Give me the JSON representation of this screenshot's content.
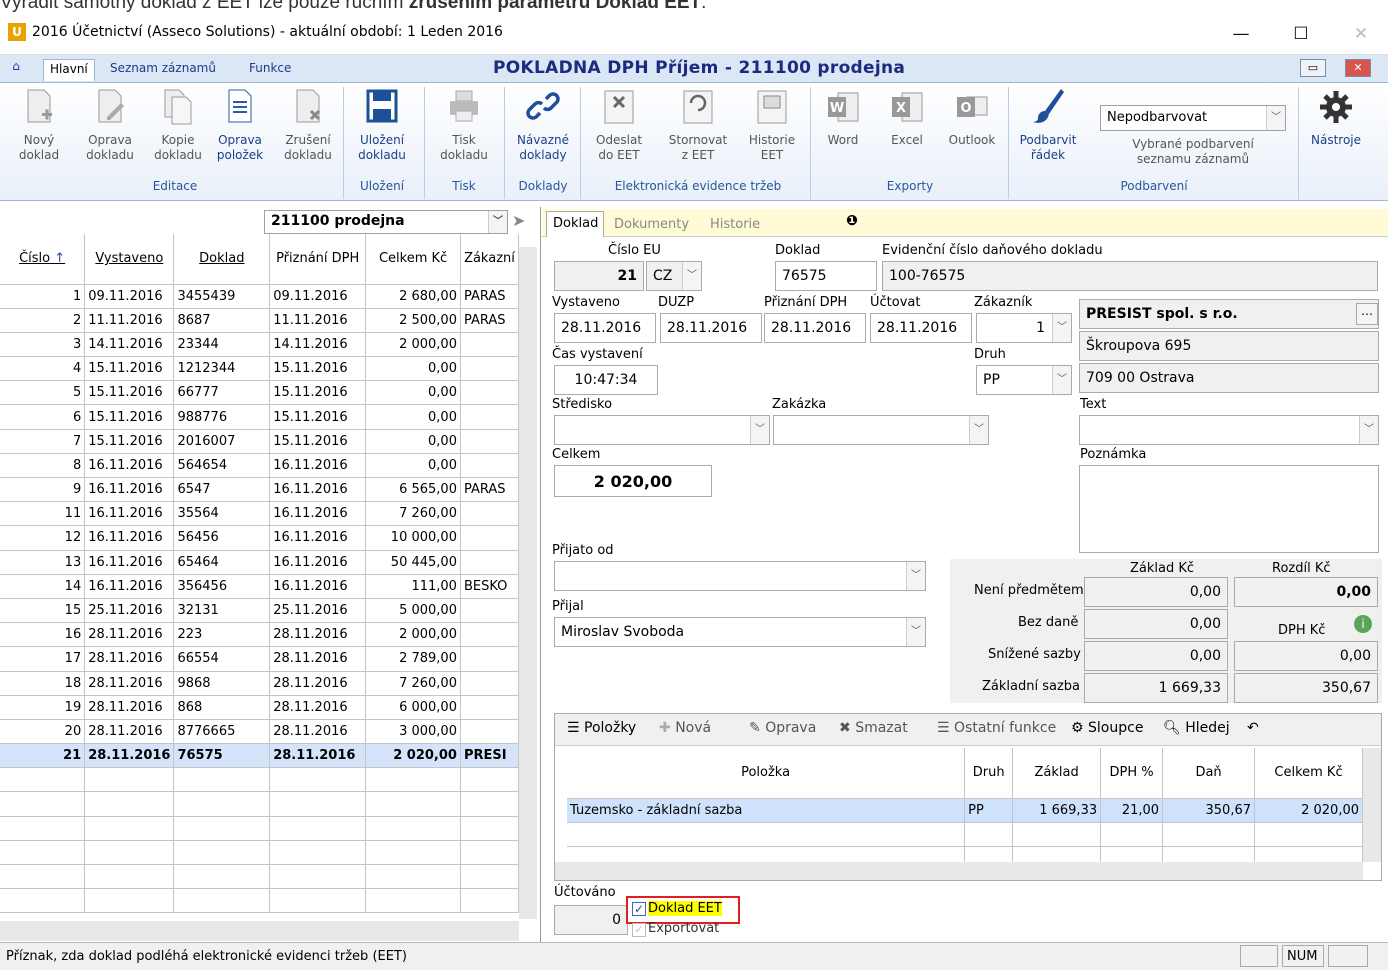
{
  "caption": {
    "pre": "Vyradit samotny doklad z EET lze pouze ručním ",
    "bold": "zrušením parametru Doklad EET",
    "post": "."
  },
  "window": {
    "icon": "U",
    "title": "2016 Účetnictví (Asseco Solutions)  -  aktuální období: 1 Leden 2016",
    "min": "—",
    "max": "☐",
    "close": "✕"
  },
  "tabs": [
    "Hlavní",
    "Seznam záznamů",
    "Funkce"
  ],
  "form_title": "POKLADNA DPH Příjem - 211100  prodejna",
  "ribbon": {
    "buttons": [
      {
        "l1": "Nový",
        "l2": "doklad"
      },
      {
        "l1": "Oprava",
        "l2": "dokladu"
      },
      {
        "l1": "Kopie",
        "l2": "dokladu"
      },
      {
        "l1": "Oprava",
        "l2": "položek"
      },
      {
        "l1": "Zrušení",
        "l2": "dokladu"
      },
      {
        "l1": "Uložení",
        "l2": "dokladu"
      },
      {
        "l1": "Tisk",
        "l2": "dokladu"
      },
      {
        "l1": "Návazné",
        "l2": "doklady"
      },
      {
        "l1": "Odeslat",
        "l2": "do EET"
      },
      {
        "l1": "Stornovat",
        "l2": "z EET"
      },
      {
        "l1": "Historie",
        "l2": "EET"
      },
      {
        "l1": "Word",
        "l2": ""
      },
      {
        "l1": "Excel",
        "l2": ""
      },
      {
        "l1": "Outlook",
        "l2": ""
      },
      {
        "l1": "Podbarvit",
        "l2": "řádek"
      },
      {
        "l1": "Nástroje",
        "l2": ""
      }
    ],
    "groups": [
      "Editace",
      "Uložení",
      "Tisk",
      "Doklady",
      "Elektronická evidence tržeb",
      "Exporty",
      "Podbarvení"
    ],
    "color_select": "Nepodbarvovat",
    "color_note1": "Vybrané podbarvení",
    "color_note2": "seznamu záznamů",
    "eet_badge": "EET",
    "office": {
      "word": "W",
      "excel": "X",
      "outlook": "O"
    }
  },
  "list": {
    "selector": "211100   prodejna",
    "headers": [
      "Číslo",
      "Vystaveno",
      "Doklad",
      "Přiznání DPH",
      "Celkem Kč",
      "Zákazní"
    ],
    "rows": [
      [
        "1",
        "09.11.2016",
        "3455439",
        "09.11.2016",
        "2 680,00",
        "PARAS"
      ],
      [
        "2",
        "11.11.2016",
        "8687",
        "11.11.2016",
        "2 500,00",
        "PARAS"
      ],
      [
        "3",
        "14.11.2016",
        "23344",
        "14.11.2016",
        "2 000,00",
        ""
      ],
      [
        "4",
        "15.11.2016",
        "1212344",
        "15.11.2016",
        "0,00",
        ""
      ],
      [
        "5",
        "15.11.2016",
        "66777",
        "15.11.2016",
        "0,00",
        ""
      ],
      [
        "6",
        "15.11.2016",
        "988776",
        "15.11.2016",
        "0,00",
        ""
      ],
      [
        "7",
        "15.11.2016",
        "2016007",
        "15.11.2016",
        "0,00",
        ""
      ],
      [
        "8",
        "16.11.2016",
        "564654",
        "16.11.2016",
        "0,00",
        ""
      ],
      [
        "9",
        "16.11.2016",
        "6547",
        "16.11.2016",
        "6 565,00",
        "PARAS"
      ],
      [
        "11",
        "16.11.2016",
        "35564",
        "16.11.2016",
        "7 260,00",
        ""
      ],
      [
        "12",
        "16.11.2016",
        "56456",
        "16.11.2016",
        "10 000,00",
        ""
      ],
      [
        "13",
        "16.11.2016",
        "65464",
        "16.11.2016",
        "50 445,00",
        ""
      ],
      [
        "14",
        "16.11.2016",
        "356456",
        "16.11.2016",
        "111,00",
        "BESKO"
      ],
      [
        "15",
        "25.11.2016",
        "32131",
        "25.11.2016",
        "5 000,00",
        ""
      ],
      [
        "16",
        "28.11.2016",
        "223",
        "28.11.2016",
        "2 000,00",
        ""
      ],
      [
        "17",
        "28.11.2016",
        "66554",
        "28.11.2016",
        "2 789,00",
        ""
      ],
      [
        "18",
        "28.11.2016",
        "9868",
        "28.11.2016",
        "7 260,00",
        ""
      ],
      [
        "19",
        "28.11.2016",
        "868",
        "28.11.2016",
        "6 000,00",
        ""
      ],
      [
        "20",
        "28.11.2016",
        "8776665",
        "28.11.2016",
        "3 000,00",
        ""
      ],
      [
        "21",
        "28.11.2016",
        "76575",
        "28.11.2016",
        "2 020,00",
        "PRESI"
      ]
    ]
  },
  "detail": {
    "tabs": [
      "Doklad",
      "Dokumenty",
      "Historie"
    ],
    "lbl_cislo_eu": "Číslo EU",
    "cislo": "21",
    "zeme": "CZ",
    "lbl_doklad": "Doklad",
    "doklad": "76575",
    "lbl_evid": "Evidenční číslo daňového dokladu",
    "evid": "100-76575",
    "lbl_vystaveno": "Vystaveno",
    "vystaveno": "28.11.2016",
    "lbl_duzp": "DUZP",
    "duzp": "28.11.2016",
    "lbl_priznani": "Přiznání DPH",
    "priznani": "28.11.2016",
    "lbl_uctovat": "Účtovat",
    "uctovat": "28.11.2016",
    "lbl_zakaznik": "Zákazník",
    "zakaznik": "1",
    "cust_name": "PRESIST spol. s r.o.",
    "cust_street": "Škroupova 695",
    "cust_city": "709 00 Ostrava",
    "lbl_cas": "Čas vystavení",
    "cas": "10:47:34",
    "lbl_druh": "Druh",
    "druh": "PP",
    "lbl_stredisko": "Středisko",
    "lbl_zakazka": "Zakázka",
    "lbl_text": "Text",
    "lbl_celkem": "Celkem",
    "celkem": "2 020,00",
    "lbl_poznamka": "Poznámka",
    "lbl_prijato": "Přijato od",
    "lbl_prijal": "Přijal",
    "prijal": "Miroslav Svoboda",
    "vat": {
      "h_zaklad": "Základ Kč",
      "h_rozdil": "Rozdíl Kč",
      "h_dph": "DPH Kč",
      "rows": [
        {
          "label": "Není předmětem",
          "zaklad": "0,00",
          "other": "0,00"
        },
        {
          "label": "Bez daně",
          "zaklad": "0,00",
          "other": ""
        },
        {
          "label": "Snížené sazby",
          "zaklad": "0,00",
          "other": "0,00"
        },
        {
          "label": "Základní sazba",
          "zaklad": "1 669,33",
          "other": "350,67"
        }
      ]
    },
    "items_toolbar": [
      "Položky",
      "Nová",
      "Oprava",
      "Smazat",
      "Ostatní funkce",
      "Sloupce",
      "Hledej"
    ],
    "items_headers": [
      "Položka",
      "Druh",
      "Základ",
      "DPH %",
      "Daň",
      "Celkem Kč"
    ],
    "items": [
      [
        "Tuzemsko - základní sazba",
        "PP",
        "1 669,33",
        "21,00",
        "350,67",
        "2 020,00"
      ]
    ],
    "lbl_uctovano": "Účtováno",
    "uctovano": "0",
    "chk_eet": "Doklad EET",
    "chk_export": "Exportovat"
  },
  "statusbar": {
    "text": "Příznak, zda doklad podléhá elektronické evidenci tržeb (EET)",
    "num": "NUM"
  }
}
